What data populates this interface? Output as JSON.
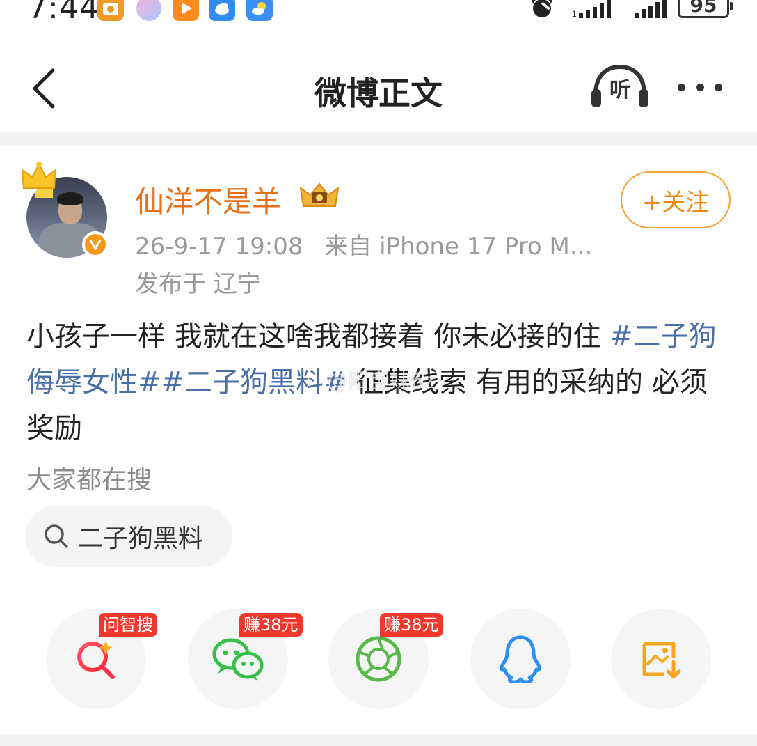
{
  "status_bar": {
    "time": "7:44",
    "battery": "95",
    "app_icons": [
      "wallet-icon",
      "assistant-icon",
      "video-icon",
      "cloud-icon",
      "weather-icon"
    ]
  },
  "nav": {
    "title": "微博正文",
    "listen_label": "听"
  },
  "post": {
    "username": "仙洋不是羊",
    "date": "26-9-17 19:08",
    "source": "来自 iPhone 17 Pro M...",
    "location": "发布于 辽宁",
    "follow_label": "+关注",
    "text_segments": {
      "intro": "小孩子一样 我就在这啥我都接着 你未必接的住 ",
      "hashtag_1": "#二子狗侮辱女性#",
      "hashtag_2": "#二子狗黑料#",
      "outro": " 征集线索 有用的采纳的 必须奖励"
    },
    "watermark": "@阳宝妹6z"
  },
  "search": {
    "section_label": "大家都在搜",
    "chip_text": "二子狗黑料"
  },
  "share": {
    "badges": [
      "问智搜",
      "赚38元",
      "赚38元"
    ],
    "items": [
      "ai-search-icon",
      "wechat-icon",
      "moments-icon",
      "qq-icon",
      "save-image-icon"
    ]
  },
  "colors": {
    "accent_orange": "#e8701a",
    "hashtag_blue": "#4a6ea6",
    "meta_gray": "#9a9a9a",
    "badge_red": "#f0382e"
  }
}
